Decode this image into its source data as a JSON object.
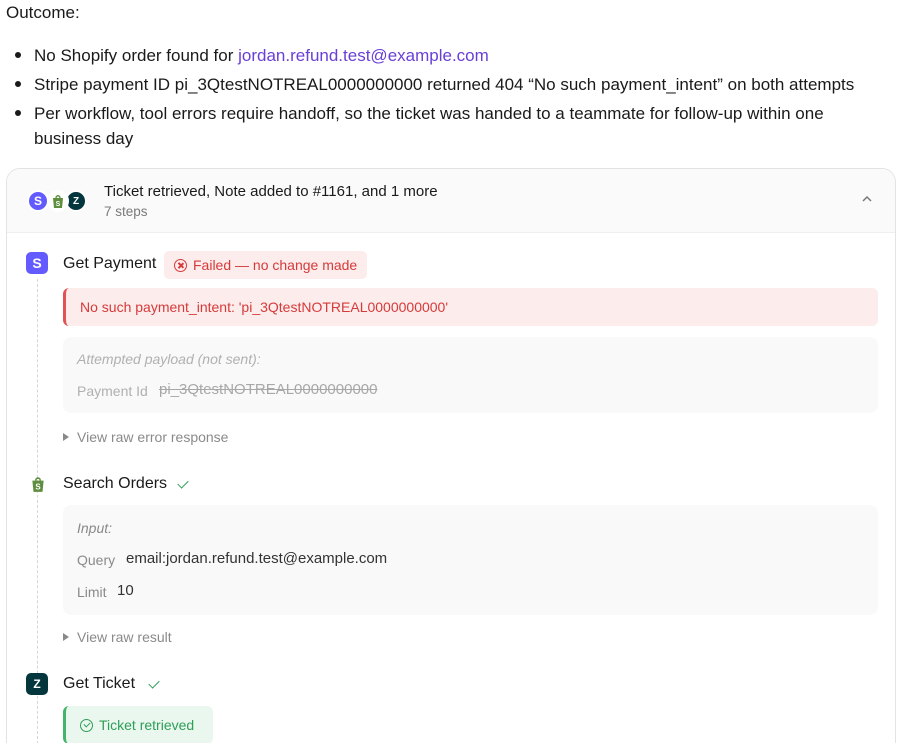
{
  "outcome": {
    "heading": "Outcome:",
    "bullets": [
      {
        "prefix": "No Shopify order found for ",
        "link": "jordan.refund.test@example.com"
      },
      {
        "text": "Stripe payment ID pi_3QtestNOTREAL0000000000 returned 404 “No such payment_intent” on both attempts"
      },
      {
        "text": "Per workflow, tool errors require handoff, so the ticket was handed to a teammate for follow-up within one business day"
      }
    ]
  },
  "steps_card": {
    "title": "Ticket retrieved, Note added to #1161, and 1 more",
    "subtitle": "7 steps",
    "icons": [
      "stripe-icon",
      "shopify-icon",
      "zendesk-icon"
    ],
    "steps": [
      {
        "title": "Get Payment",
        "icon": "stripe-icon",
        "status_label": "Failed — no change made",
        "error_message": "No such payment_intent: 'pi_3QtestNOTREAL0000000000'",
        "payload_label": "Attempted payload (not sent):",
        "payload_key": "Payment Id",
        "payload_value": "pi_3QtestNOTREAL0000000000",
        "disclosure": "View raw error response"
      },
      {
        "title": "Search Orders",
        "icon": "shopify-icon",
        "input_label": "Input:",
        "query_key": "Query",
        "query_value": "email:jordan.refund.test@example.com",
        "limit_key": "Limit",
        "limit_value": "10",
        "disclosure": "View raw result"
      },
      {
        "title": "Get Ticket",
        "icon": "zendesk-icon",
        "result_label": "Ticket retrieved"
      }
    ]
  },
  "colors": {
    "link": "#6a3fd6",
    "stripe": "#635bff",
    "shopify": "#5e8e3e",
    "zendesk": "#03363d",
    "error": "#d63a3a",
    "success": "#2e9e58"
  }
}
